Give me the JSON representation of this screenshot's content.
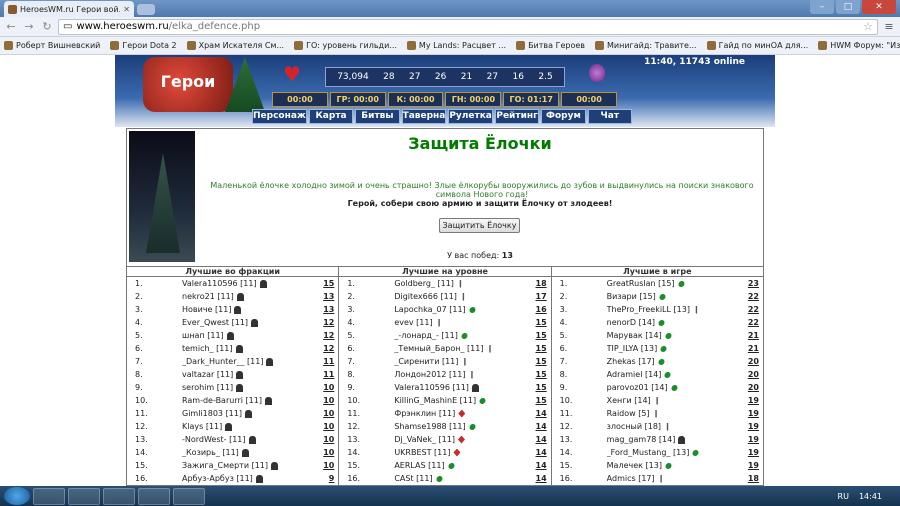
{
  "browser": {
    "tab_title": "HeroesWM.ru Герои вой...",
    "url_domain": "www.heroeswm.ru",
    "url_path": "/elka_defence.php",
    "bookmarks": [
      "Роберт Вишневский",
      "Герои Dota 2",
      "Храм Искателя См...",
      "ГО: уровень гильди...",
      "My Lands: Расцвет ...",
      "Битва Героев",
      "Минигайд: Травите...",
      "Гайд по минОА для...",
      "HWM Форум: \"Изо..."
    ]
  },
  "header": {
    "logo_text": "Герои",
    "resources": [
      "73,094",
      "28",
      "27",
      "26",
      "21",
      "27",
      "16",
      "2.5"
    ],
    "online_text": "11:40, 11743 online",
    "timers": [
      "00:00",
      "ГР: 00:00",
      "К: 00:00",
      "ГН: 00:00",
      "ГО: 01:17",
      "00:00"
    ],
    "nav": [
      "Персонаж",
      "Карта",
      "Битвы",
      "Таверна",
      "Рулетка",
      "Рейтинг",
      "Форум",
      "Чат"
    ]
  },
  "main": {
    "title": "Защита Ёлочки",
    "description": "Маленькой ёлочке холодно зимой и очень страшно! Злые ёлкорубы вооружились до зубов и выдвинулись на поиски знакового символа Нового года!",
    "call": "Герой, собери свою армию и защити Ёлочку от злодеев!",
    "button": "Защитить Ёлочку",
    "wins_label": "У вас побед:",
    "wins_value": "13"
  },
  "columns": [
    {
      "header": "Лучшие во фракции",
      "rows": [
        {
          "n": "1.",
          "name": "Valera110596 [11]",
          "f": "k",
          "s": "15"
        },
        {
          "n": "2.",
          "name": "nekro21 [11]",
          "f": "k",
          "s": "13"
        },
        {
          "n": "3.",
          "name": "Новиче [11]",
          "f": "k",
          "s": "13"
        },
        {
          "n": "4.",
          "name": "Ever_Qwest [11]",
          "f": "k",
          "s": "12"
        },
        {
          "n": "5.",
          "name": "шнап [11]",
          "f": "k",
          "s": "12"
        },
        {
          "n": "6.",
          "name": "temich_ [11]",
          "f": "k",
          "s": "12"
        },
        {
          "n": "7.",
          "name": "_Dark_Hunter__ [11]",
          "f": "k",
          "s": "11"
        },
        {
          "n": "8.",
          "name": "valtazar [11]",
          "f": "k",
          "s": "11"
        },
        {
          "n": "9.",
          "name": "serohim [11]",
          "f": "k",
          "s": "10"
        },
        {
          "n": "10.",
          "name": "Ram-de-Barurri [11]",
          "f": "k",
          "s": "10"
        },
        {
          "n": "11.",
          "name": "Gimli1803 [11]",
          "f": "k",
          "s": "10"
        },
        {
          "n": "12.",
          "name": "Klays [11]",
          "f": "k",
          "s": "10"
        },
        {
          "n": "13.",
          "name": "-NordWest- [11]",
          "f": "k",
          "s": "10"
        },
        {
          "n": "14.",
          "name": "_Козирь_ [11]",
          "f": "k",
          "s": "10"
        },
        {
          "n": "15.",
          "name": "Зажига_Смерти [11]",
          "f": "k",
          "s": "10"
        },
        {
          "n": "16.",
          "name": "Арбуз-Арбуз [11]",
          "f": "k",
          "s": "9"
        }
      ]
    },
    {
      "header": "Лучшие на уровне",
      "rows": [
        {
          "n": "1.",
          "name": "Goldberg_ [11]",
          "f": "w",
          "s": "18"
        },
        {
          "n": "2.",
          "name": "Digitex666 [11]",
          "f": "w",
          "s": "17"
        },
        {
          "n": "3.",
          "name": "Lapochka_07 [11]",
          "f": "g",
          "s": "16"
        },
        {
          "n": "4.",
          "name": "evev [11]",
          "f": "w",
          "s": "15"
        },
        {
          "n": "5.",
          "name": "_-лонард_- [11]",
          "f": "g",
          "s": "15"
        },
        {
          "n": "6.",
          "name": "_Темный_Барон_ [11]",
          "f": "w",
          "s": "15"
        },
        {
          "n": "7.",
          "name": "_Сиренити [11]",
          "f": "w",
          "s": "15"
        },
        {
          "n": "8.",
          "name": "Лондон2012 [11]",
          "f": "w",
          "s": "15"
        },
        {
          "n": "9.",
          "name": "Valera110596 [11]",
          "f": "k",
          "s": "15"
        },
        {
          "n": "10.",
          "name": "KillinG_MashinE [11]",
          "f": "g",
          "s": "15"
        },
        {
          "n": "11.",
          "name": "Фрэнклин [11]",
          "f": "r",
          "s": "14"
        },
        {
          "n": "12.",
          "name": "Shamse1988 [11]",
          "f": "g",
          "s": "14"
        },
        {
          "n": "13.",
          "name": "Dj_VaNek_ [11]",
          "f": "r",
          "s": "14"
        },
        {
          "n": "14.",
          "name": "UKRBEST [11]",
          "f": "r",
          "s": "14"
        },
        {
          "n": "15.",
          "name": "AERLAS [11]",
          "f": "g",
          "s": "14"
        },
        {
          "n": "16.",
          "name": "CASt [11]",
          "f": "g",
          "s": "14"
        }
      ]
    },
    {
      "header": "Лучшие в игре",
      "rows": [
        {
          "n": "1.",
          "name": "GreatRuslan [15]",
          "f": "g",
          "s": "23"
        },
        {
          "n": "2.",
          "name": "Визари [15]",
          "f": "g",
          "s": "22"
        },
        {
          "n": "3.",
          "name": "ThePro_FreekiLL [13]",
          "f": "w",
          "s": "22"
        },
        {
          "n": "4.",
          "name": "nenorD [14]",
          "f": "g",
          "s": "22"
        },
        {
          "n": "5.",
          "name": "Марувак [14]",
          "f": "g",
          "s": "21"
        },
        {
          "n": "6.",
          "name": "TIP_ILYA [13]",
          "f": "g",
          "s": "21"
        },
        {
          "n": "7.",
          "name": "Zhekas [17]",
          "f": "g",
          "s": "20"
        },
        {
          "n": "8.",
          "name": "Adramiel [14]",
          "f": "g",
          "s": "20"
        },
        {
          "n": "9.",
          "name": "parovoz01 [14]",
          "f": "g",
          "s": "20"
        },
        {
          "n": "10.",
          "name": "Хенги [14]",
          "f": "w",
          "s": "19"
        },
        {
          "n": "11.",
          "name": "Raidow [5]",
          "f": "w",
          "s": "19"
        },
        {
          "n": "12.",
          "name": "злосный [18]",
          "f": "w",
          "s": "19"
        },
        {
          "n": "13.",
          "name": "mag_gam78 [14]",
          "f": "k",
          "s": "19"
        },
        {
          "n": "14.",
          "name": "_Ford_Mustang_ [13]",
          "f": "g",
          "s": "19"
        },
        {
          "n": "15.",
          "name": "Малечек [13]",
          "f": "g",
          "s": "19"
        },
        {
          "n": "16.",
          "name": "Admics [17]",
          "f": "w",
          "s": "18"
        }
      ]
    }
  ],
  "taskbar": {
    "lang": "RU",
    "time": "14:41"
  }
}
